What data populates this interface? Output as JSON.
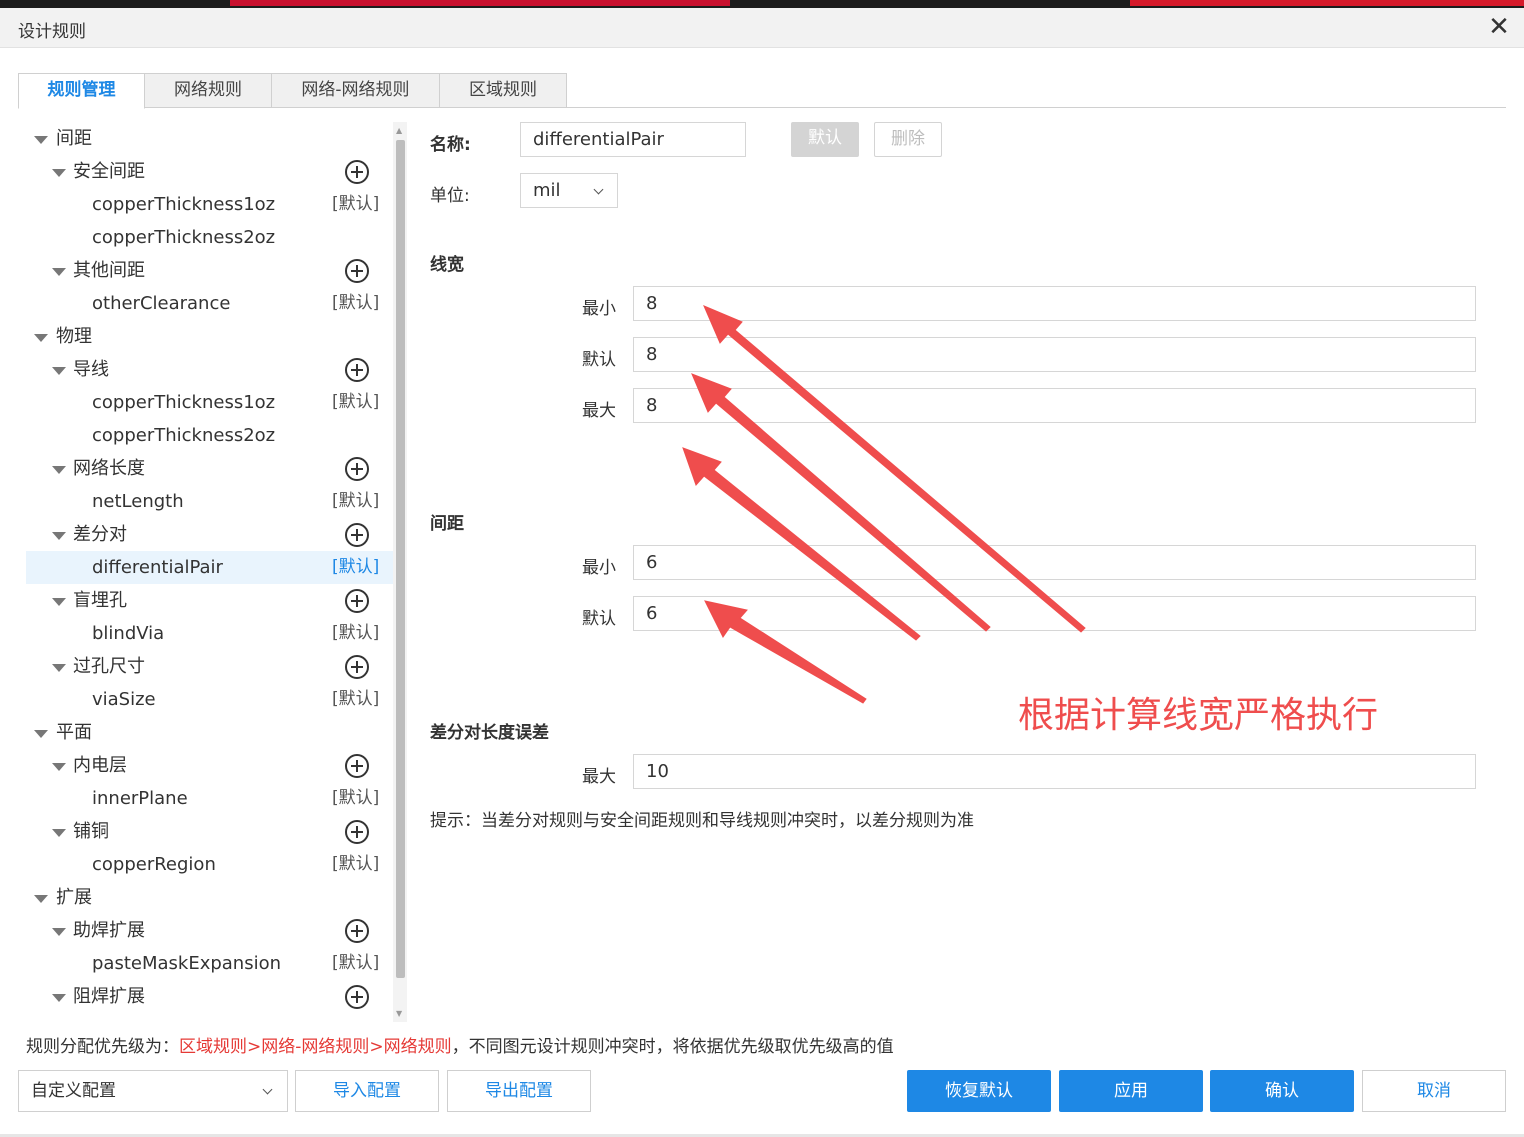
{
  "window": {
    "title": "设计规则"
  },
  "tabs": [
    "规则管理",
    "网络规则",
    "网络-网络规则",
    "区域规则"
  ],
  "tree": [
    {
      "label": "间距",
      "level": 0
    },
    {
      "label": "安全间距",
      "level": 1,
      "add": true
    },
    {
      "label": "copperThickness1oz",
      "level": 2,
      "tag": "[默认]"
    },
    {
      "label": "copperThickness2oz",
      "level": 2
    },
    {
      "label": "其他间距",
      "level": 1,
      "add": true
    },
    {
      "label": "otherClearance",
      "level": 2,
      "tag": "[默认]"
    },
    {
      "label": "物理",
      "level": 0
    },
    {
      "label": "导线",
      "level": 1,
      "add": true
    },
    {
      "label": "copperThickness1oz",
      "level": 2,
      "tag": "[默认]"
    },
    {
      "label": "copperThickness2oz",
      "level": 2
    },
    {
      "label": "网络长度",
      "level": 1,
      "add": true
    },
    {
      "label": "netLength",
      "level": 2,
      "tag": "[默认]"
    },
    {
      "label": "差分对",
      "level": 1,
      "add": true
    },
    {
      "label": "differentialPair",
      "level": 2,
      "tag": "[默认]",
      "selected": true
    },
    {
      "label": "盲埋孔",
      "level": 1,
      "add": true
    },
    {
      "label": "blindVia",
      "level": 2,
      "tag": "[默认]"
    },
    {
      "label": "过孔尺寸",
      "level": 1,
      "add": true
    },
    {
      "label": "viaSize",
      "level": 2,
      "tag": "[默认]"
    },
    {
      "label": "平面",
      "level": 0
    },
    {
      "label": "内电层",
      "level": 1,
      "add": true
    },
    {
      "label": "innerPlane",
      "level": 2,
      "tag": "[默认]"
    },
    {
      "label": "铺铜",
      "level": 1,
      "add": true
    },
    {
      "label": "copperRegion",
      "level": 2,
      "tag": "[默认]"
    },
    {
      "label": "扩展",
      "level": 0
    },
    {
      "label": "助焊扩展",
      "level": 1,
      "add": true
    },
    {
      "label": "pasteMaskExpansion",
      "level": 2,
      "tag": "[默认]"
    },
    {
      "label": "阻焊扩展",
      "level": 1,
      "add": true
    }
  ],
  "form": {
    "name_label": "名称:",
    "name_value": "differentialPair",
    "default_button": "默认",
    "delete_button": "删除",
    "unit_label": "单位:",
    "unit_value": "mil",
    "width_section": "线宽",
    "width_min_label": "最小",
    "width_min_value": "8",
    "width_default_label": "默认",
    "width_default_value": "8",
    "width_max_label": "最大",
    "width_max_value": "8",
    "gap_section": "间距",
    "gap_min_label": "最小",
    "gap_min_value": "6",
    "gap_default_label": "默认",
    "gap_default_value": "6",
    "len_section": "差分对长度误差",
    "len_max_label": "最大",
    "len_max_value": "10",
    "hint": "提示：当差分对规则与安全间距规则和导线规则冲突时，以差分规则为准"
  },
  "annotation": {
    "text": "根据计算线宽严格执行",
    "color": "#ef4d4d"
  },
  "priority": {
    "prefix": "规则分配优先级为：",
    "order": "区域规则>网络-网络规则>网络规则",
    "suffix": "，不同图元设计规则冲突时，将依据优先级取优先级高的值"
  },
  "footer": {
    "config_select": "自定义配置",
    "import_button": "导入配置",
    "export_button": "导出配置",
    "restore_button": "恢复默认",
    "apply_button": "应用",
    "confirm_button": "确认",
    "cancel_button": "取消"
  },
  "colors": {
    "primary": "#1e88e5",
    "accent_red": "#e53935",
    "selected_bg": "#e9f4fd"
  }
}
